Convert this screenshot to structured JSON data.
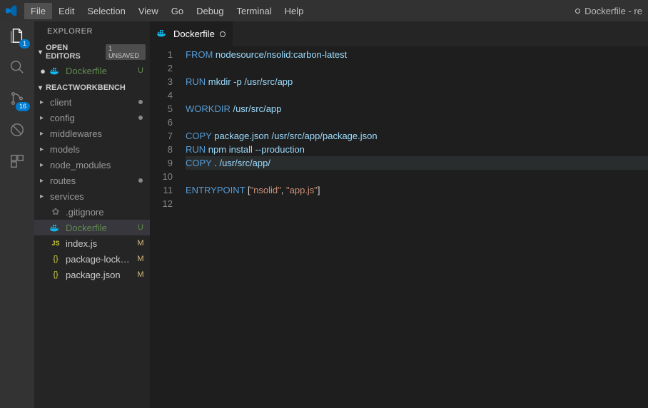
{
  "menu": [
    "File",
    "Edit",
    "Selection",
    "View",
    "Go",
    "Debug",
    "Terminal",
    "Help"
  ],
  "menu_active_index": 0,
  "window_title_tail": "Dockerfile - re",
  "activity": {
    "explorer_badge": "1",
    "scm_badge": "16"
  },
  "explorer": {
    "title": "EXPLORER",
    "open_editors": {
      "label": "OPEN EDITORS",
      "badge": "1 UNSAVED",
      "items": [
        {
          "label": "Dockerfile",
          "status": "U",
          "dirty": true
        }
      ]
    },
    "workspace": {
      "label": "REACTWORKBENCH",
      "folders": [
        {
          "label": "client",
          "mod": true
        },
        {
          "label": "config",
          "mod": true
        },
        {
          "label": "middlewares",
          "mod": false
        },
        {
          "label": "models",
          "mod": false
        },
        {
          "label": "node_modules",
          "mod": false
        },
        {
          "label": "routes",
          "mod": true
        },
        {
          "label": "services",
          "mod": false
        }
      ],
      "files": [
        {
          "label": ".gitignore",
          "kind": "gear",
          "status": ""
        },
        {
          "label": "Dockerfile",
          "kind": "docker",
          "status": "U",
          "selected": true
        },
        {
          "label": "index.js",
          "kind": "js",
          "status": "M"
        },
        {
          "label": "package-lock.json",
          "kind": "json",
          "status": "M"
        },
        {
          "label": "package.json",
          "kind": "json",
          "status": "M"
        }
      ]
    }
  },
  "tabs": [
    {
      "label": "Dockerfile",
      "dirty": true
    }
  ],
  "code": {
    "lines": [
      [
        [
          "kw",
          "FROM"
        ],
        [
          "plain",
          " "
        ],
        [
          "txt",
          "nodesource/nsolid:carbon-latest"
        ]
      ],
      [],
      [
        [
          "kw",
          "RUN"
        ],
        [
          "plain",
          " "
        ],
        [
          "txt",
          "mkdir -p /usr/src/app"
        ]
      ],
      [],
      [
        [
          "kw",
          "WORKDIR"
        ],
        [
          "plain",
          " "
        ],
        [
          "txt",
          "/usr/src/app"
        ]
      ],
      [],
      [
        [
          "kw",
          "COPY"
        ],
        [
          "plain",
          " "
        ],
        [
          "txt",
          "package.json /usr/src/app/package.json"
        ]
      ],
      [
        [
          "kw",
          "RUN"
        ],
        [
          "plain",
          " "
        ],
        [
          "txt",
          "npm install --production"
        ]
      ],
      [
        [
          "kw",
          "COPY"
        ],
        [
          "plain",
          " "
        ],
        [
          "txt",
          ". /usr/src/app/"
        ]
      ],
      [],
      [
        [
          "kw",
          "ENTRYPOINT"
        ],
        [
          "plain",
          " ["
        ],
        [
          "str",
          "\"nsolid\""
        ],
        [
          "plain",
          ", "
        ],
        [
          "str",
          "\"app.js\""
        ],
        [
          "plain",
          "]"
        ]
      ],
      []
    ],
    "cursor_line": 9
  }
}
